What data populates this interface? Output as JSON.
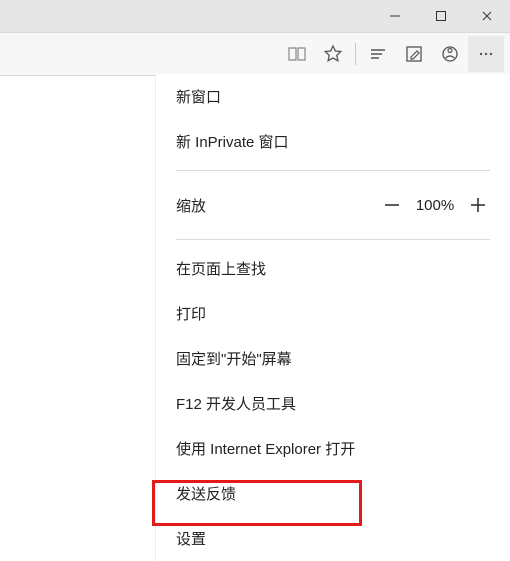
{
  "titlebar": {
    "minimize": "—",
    "maximize": "▢",
    "close": "✕"
  },
  "toolbar": {
    "read_icon": "reading-view",
    "fav_icon": "favorite",
    "hub_icon": "hub",
    "note_icon": "web-note",
    "share_icon": "share",
    "more_icon": "more"
  },
  "menu": {
    "new_window": "新窗口",
    "new_inprivate": "新 InPrivate 窗口",
    "zoom_label": "缩放",
    "zoom_value": "100%",
    "find_on_page": "在页面上查找",
    "print": "打印",
    "pin_to_start": "固定到\"开始\"屏幕",
    "f12_tools": "F12 开发人员工具",
    "open_with_ie": "使用 Internet Explorer 打开",
    "send_feedback": "发送反馈",
    "settings": "设置"
  }
}
